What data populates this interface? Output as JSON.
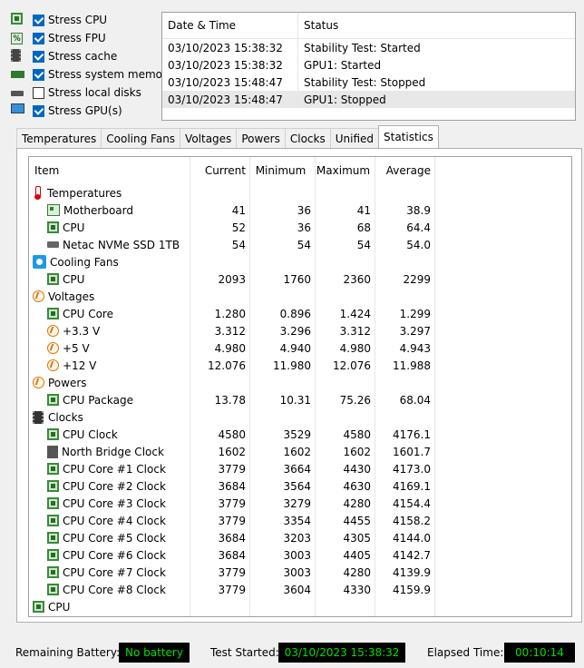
{
  "stress_options": [
    {
      "label": "Stress CPU",
      "checked": true,
      "icon": "cpu-chip-icon"
    },
    {
      "label": "Stress FPU",
      "checked": true,
      "icon": "fpu-icon"
    },
    {
      "label": "Stress cache",
      "checked": true,
      "icon": "cache-icon"
    },
    {
      "label": "Stress system memory",
      "checked": true,
      "icon": "memory-icon"
    },
    {
      "label": "Stress local disks",
      "checked": false,
      "icon": "disk-icon"
    },
    {
      "label": "Stress GPU(s)",
      "checked": true,
      "icon": "monitor-icon"
    }
  ],
  "log": {
    "headers": {
      "date": "Date & Time",
      "status": "Status"
    },
    "rows": [
      {
        "date": "03/10/2023 15:38:32",
        "status": "Stability Test: Started"
      },
      {
        "date": "03/10/2023 15:38:32",
        "status": "GPU1: Started"
      },
      {
        "date": "03/10/2023 15:48:47",
        "status": "Stability Test: Stopped"
      },
      {
        "date": "03/10/2023 15:48:47",
        "status": "GPU1: Stopped"
      }
    ]
  },
  "tabs": [
    "Temperatures",
    "Cooling Fans",
    "Voltages",
    "Powers",
    "Clocks",
    "Unified",
    "Statistics"
  ],
  "active_tab": "Statistics",
  "stats": {
    "headers": {
      "item": "Item",
      "current": "Current",
      "minimum": "Minimum",
      "maximum": "Maximum",
      "average": "Average"
    },
    "rows": [
      {
        "group": true,
        "label": "Temperatures",
        "icon": "thermometer-icon"
      },
      {
        "label": "Motherboard",
        "icon": "motherboard-icon",
        "current": "41",
        "minimum": "36",
        "maximum": "41",
        "average": "38.9"
      },
      {
        "label": "CPU",
        "icon": "cpu-chip-icon",
        "current": "52",
        "minimum": "36",
        "maximum": "68",
        "average": "64.4"
      },
      {
        "label": "Netac NVMe SSD 1TB",
        "icon": "ssd-icon",
        "current": "54",
        "minimum": "54",
        "maximum": "54",
        "average": "54.0"
      },
      {
        "group": true,
        "label": "Cooling Fans",
        "icon": "fan-icon"
      },
      {
        "label": "CPU",
        "icon": "cpu-chip-icon",
        "current": "2093",
        "minimum": "1760",
        "maximum": "2360",
        "average": "2299"
      },
      {
        "group": true,
        "label": "Voltages",
        "icon": "voltage-icon"
      },
      {
        "label": "CPU Core",
        "icon": "cpu-chip-icon",
        "current": "1.280",
        "minimum": "0.896",
        "maximum": "1.424",
        "average": "1.299"
      },
      {
        "label": "+3.3 V",
        "icon": "voltage-icon",
        "current": "3.312",
        "minimum": "3.296",
        "maximum": "3.312",
        "average": "3.297"
      },
      {
        "label": "+5 V",
        "icon": "voltage-icon",
        "current": "4.980",
        "minimum": "4.940",
        "maximum": "4.980",
        "average": "4.943"
      },
      {
        "label": "+12 V",
        "icon": "voltage-icon",
        "current": "12.076",
        "minimum": "11.980",
        "maximum": "12.076",
        "average": "11.988"
      },
      {
        "group": true,
        "label": "Powers",
        "icon": "voltage-icon"
      },
      {
        "label": "CPU Package",
        "icon": "cpu-chip-icon",
        "current": "13.78",
        "minimum": "10.31",
        "maximum": "75.26",
        "average": "68.04"
      },
      {
        "group": true,
        "label": "Clocks",
        "icon": "clock-chip-icon"
      },
      {
        "label": "CPU Clock",
        "icon": "cpu-chip-icon",
        "current": "4580",
        "minimum": "3529",
        "maximum": "4580",
        "average": "4176.1"
      },
      {
        "label": "North Bridge Clock",
        "icon": "north-bridge-icon",
        "current": "1602",
        "minimum": "1602",
        "maximum": "1602",
        "average": "1601.7"
      },
      {
        "label": "CPU Core #1 Clock",
        "icon": "cpu-chip-icon",
        "current": "3779",
        "minimum": "3664",
        "maximum": "4430",
        "average": "4173.0"
      },
      {
        "label": "CPU Core #2 Clock",
        "icon": "cpu-chip-icon",
        "current": "3684",
        "minimum": "3564",
        "maximum": "4630",
        "average": "4169.1"
      },
      {
        "label": "CPU Core #3 Clock",
        "icon": "cpu-chip-icon",
        "current": "3779",
        "minimum": "3279",
        "maximum": "4280",
        "average": "4154.4"
      },
      {
        "label": "CPU Core #4 Clock",
        "icon": "cpu-chip-icon",
        "current": "3779",
        "minimum": "3354",
        "maximum": "4455",
        "average": "4158.2"
      },
      {
        "label": "CPU Core #5 Clock",
        "icon": "cpu-chip-icon",
        "current": "3684",
        "minimum": "3203",
        "maximum": "4305",
        "average": "4144.0"
      },
      {
        "label": "CPU Core #6 Clock",
        "icon": "cpu-chip-icon",
        "current": "3684",
        "minimum": "3003",
        "maximum": "4405",
        "average": "4142.7"
      },
      {
        "label": "CPU Core #7 Clock",
        "icon": "cpu-chip-icon",
        "current": "3779",
        "minimum": "3003",
        "maximum": "4280",
        "average": "4139.9"
      },
      {
        "label": "CPU Core #8 Clock",
        "icon": "cpu-chip-icon",
        "current": "3779",
        "minimum": "3604",
        "maximum": "4330",
        "average": "4159.9"
      },
      {
        "group": true,
        "label": "CPU",
        "icon": "cpu-chip-icon"
      }
    ]
  },
  "footer": {
    "remaining_battery_label": "Remaining Battery:",
    "remaining_battery_value": "No battery",
    "test_started_label": "Test Started:",
    "test_started_value": "03/10/2023 15:38:32",
    "elapsed_time_label": "Elapsed Time:",
    "elapsed_time_value": "00:10:14"
  },
  "colors": {
    "check_blue": "#0067c0",
    "readout_green": "#00e000",
    "readout_bg": "#000000"
  }
}
